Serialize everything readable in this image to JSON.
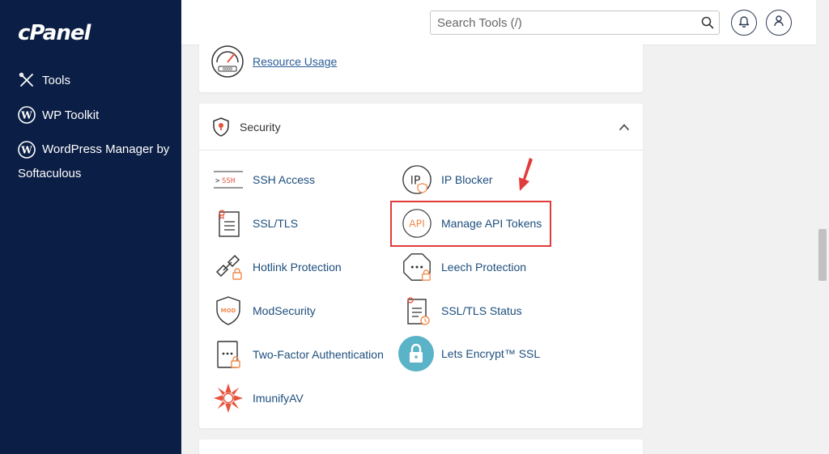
{
  "sidebar": {
    "logo": "cPanel",
    "items": [
      {
        "label": "Tools",
        "icon": "tools-icon"
      },
      {
        "label": "WP Toolkit",
        "icon": "wordpress-icon"
      },
      {
        "label": "WordPress Manager by Softaculous",
        "icon": "wordpress-icon"
      }
    ]
  },
  "topbar": {
    "search_placeholder": "Search Tools (/)",
    "search_icon": "search-icon",
    "notifications_icon": "bell-icon",
    "user_icon": "user-icon"
  },
  "metrics_card": {
    "tools": [
      {
        "label": "Resource Usage",
        "icon": "speedometer-icon"
      }
    ]
  },
  "security": {
    "title": "Security",
    "collapse_icon": "chevron-up-icon",
    "tools": [
      {
        "label": "SSH Access",
        "icon": "ssh-icon"
      },
      {
        "label": "IP Blocker",
        "icon": "ip-blocker-icon"
      },
      {
        "label": "SSL/TLS",
        "icon": "certificate-icon"
      },
      {
        "label": "Manage API Tokens",
        "icon": "api-icon"
      },
      {
        "label": "Hotlink Protection",
        "icon": "hotlink-icon"
      },
      {
        "label": "Leech Protection",
        "icon": "leech-icon"
      },
      {
        "label": "ModSecurity",
        "icon": "mod-shield-icon"
      },
      {
        "label": "SSL/TLS Status",
        "icon": "certificate-status-icon"
      },
      {
        "label": "Two-Factor Authentication",
        "icon": "two-factor-icon"
      },
      {
        "label": "Lets Encrypt™ SSL",
        "icon": "lock-icon"
      },
      {
        "label": "ImunifyAV",
        "icon": "imunify-icon"
      }
    ]
  },
  "colors": {
    "sidebar_bg": "#0b1e45",
    "accent_orange": "#f08a4b",
    "link_blue": "#1d4e7d",
    "highlight_red": "#e23b3b"
  }
}
